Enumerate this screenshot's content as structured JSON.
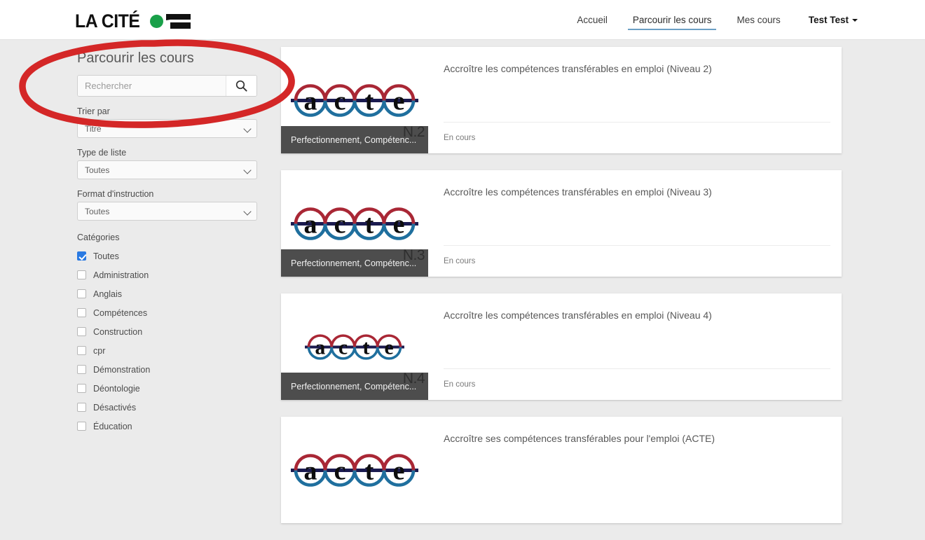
{
  "header": {
    "logo_text": "LA CITÉ",
    "logo_dot_color": "#19a049",
    "nav": [
      {
        "label": "Accueil",
        "active": false
      },
      {
        "label": "Parcourir les cours",
        "active": true
      },
      {
        "label": "Mes cours",
        "active": false
      }
    ],
    "user_menu": "Test Test",
    "active_underline_color": "#6b9fc4"
  },
  "sidebar": {
    "title": "Parcourir les cours",
    "search": {
      "placeholder": "Rechercher",
      "value": "",
      "icon": "search-icon",
      "button_label": ""
    },
    "sort": {
      "label": "Trier par",
      "value": "Titre"
    },
    "list_type": {
      "label": "Type de liste",
      "value": "Toutes"
    },
    "instruction_format": {
      "label": "Format d'instruction",
      "value": "Toutes"
    },
    "categories_label": "Catégories",
    "categories": [
      {
        "label": "Toutes",
        "checked": true
      },
      {
        "label": "Administration",
        "checked": false
      },
      {
        "label": "Anglais",
        "checked": false
      },
      {
        "label": "Compétences",
        "checked": false
      },
      {
        "label": "Construction",
        "checked": false
      },
      {
        "label": "cpr",
        "checked": false
      },
      {
        "label": "Démonstration",
        "checked": false
      },
      {
        "label": "Déontologie",
        "checked": false
      },
      {
        "label": "Désactivés",
        "checked": false
      },
      {
        "label": "Éducation",
        "checked": false
      }
    ]
  },
  "courses": [
    {
      "title": "Accroître les compétences transférables en emploi (Niveau 2)",
      "status": "En cours",
      "category_band": "Perfectionnement, Compétenc...",
      "level_badge": "N.2",
      "logo": "acte-logo",
      "logo_scale": 1.0
    },
    {
      "title": "Accroître les compétences transférables en emploi (Niveau 3)",
      "status": "En cours",
      "category_band": "Perfectionnement, Compétenc...",
      "level_badge": "N.3",
      "logo": "acte-logo",
      "logo_scale": 1.0
    },
    {
      "title": "Accroître les compétences transférables en emploi (Niveau 4)",
      "status": "En cours",
      "category_band": "Perfectionnement, Compétenc...",
      "level_badge": "N.4",
      "logo": "acte-logo",
      "logo_scale": 0.78
    },
    {
      "title": "Accroître ses compétences transférables pour l'emploi (ACTE)",
      "status": "",
      "category_band": "",
      "level_badge": "",
      "logo": "acte-logo",
      "logo_scale": 1.0
    }
  ],
  "annotation": {
    "shape": "red-ellipse-highlight",
    "color": "#d42727"
  }
}
